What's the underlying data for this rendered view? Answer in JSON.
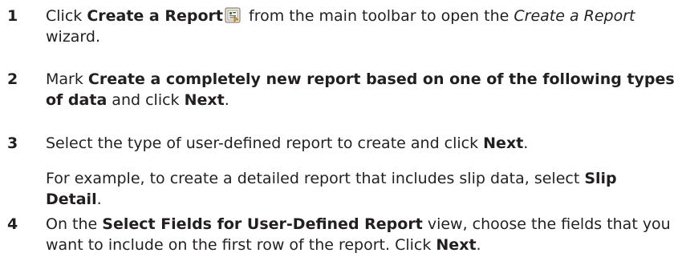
{
  "steps": [
    {
      "number": "1",
      "parts": [
        "Click ",
        "Create a Report",
        " from the main toolbar to open the ",
        "Create a Report",
        " wizard."
      ],
      "icon": "create-report-icon"
    },
    {
      "number": "2",
      "parts": [
        "Mark ",
        "Create a completely new report based on one of the following types of data",
        " and click ",
        "Next",
        "."
      ]
    },
    {
      "number": "3",
      "parts": [
        "Select the type of user-defined report to create and click ",
        "Next",
        "."
      ],
      "note_parts": [
        "For example, to create a detailed report that includes slip data, select ",
        "Slip Detail",
        "."
      ]
    },
    {
      "number": "4",
      "parts": [
        "On the ",
        "Select Fields for User-Defined Report",
        " view, choose the fields that you want to include on the first row of the report. Click ",
        "Next",
        "."
      ]
    }
  ]
}
